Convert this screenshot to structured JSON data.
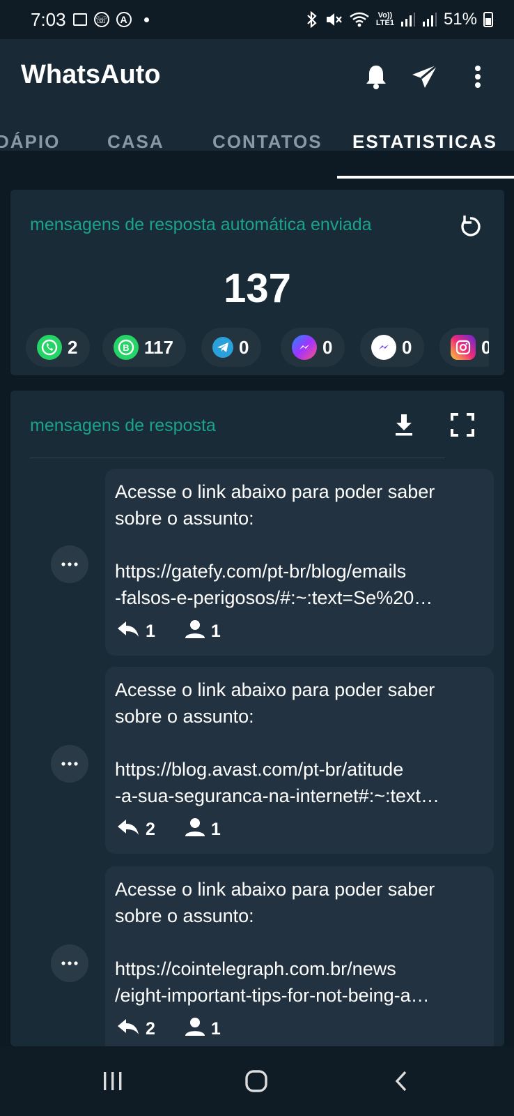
{
  "status_bar": {
    "time": "7:03",
    "battery": "51%",
    "network_label": "Vo)) LTE1"
  },
  "app_bar": {
    "title": "WhatsAuto",
    "icons": [
      "bell-icon",
      "send-icon",
      "more-vert-icon"
    ]
  },
  "tabs": [
    {
      "label": "DÁPIO",
      "active": false
    },
    {
      "label": "CASA",
      "active": false
    },
    {
      "label": "CONTATOS",
      "active": false
    },
    {
      "label": "ESTATISTICAS",
      "active": true
    }
  ],
  "stats": {
    "title": "mensagens de resposta automática enviada",
    "total": "137",
    "apps": [
      {
        "icon": "whatsapp-icon",
        "count": "2",
        "color": "#25d366"
      },
      {
        "icon": "whatsapp-business-icon",
        "count": "117",
        "color": "#25d366"
      },
      {
        "icon": "telegram-icon",
        "count": "0",
        "color": "#2aa1da"
      },
      {
        "icon": "messenger-icon",
        "count": "0",
        "color": "#8a3cf6"
      },
      {
        "icon": "messenger-lite-icon",
        "count": "0",
        "color": "#ffffff"
      },
      {
        "icon": "instagram-icon",
        "count": "0",
        "color": "#d62976"
      }
    ]
  },
  "replies": {
    "title": "mensagens de resposta",
    "messages": [
      {
        "line1": "Acesse o link abaixo para poder saber",
        "line2": "sobre o assunto:",
        "link1": "https://gatefy.com/pt-br/blog/emails",
        "link2": "-falsos-e-perigosos/#:~:text=Se%20…",
        "replies": "1",
        "contacts": "1"
      },
      {
        "line1": "Acesse o link abaixo para poder saber",
        "line2": "sobre o assunto:",
        "link1": "https://blog.avast.com/pt-br/atitude",
        "link2": "-a-sua-seguranca-na-internet#:~:text…",
        "replies": "2",
        "contacts": "1"
      },
      {
        "line1": "Acesse o link abaixo para poder saber",
        "line2": "sobre o assunto:",
        "link1": "https://cointelegraph.com.br/news",
        "link2": "/eight-important-tips-for-not-being-a…",
        "replies": "2",
        "contacts": "1"
      }
    ]
  },
  "colors": {
    "accent": "#1aa28c",
    "background": "#0d1a24",
    "card": "#1a2b38",
    "bubble": "#223240"
  }
}
